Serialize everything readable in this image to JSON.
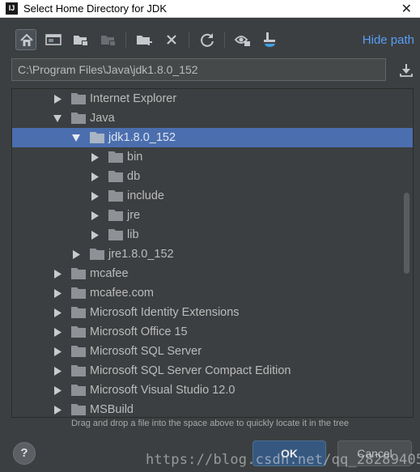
{
  "window": {
    "logo": "IJ",
    "title": "Select Home Directory for JDK",
    "close": "✕"
  },
  "toolbar": {
    "buttons": [
      {
        "icon": "home-icon",
        "tooltip": ""
      },
      {
        "icon": "desktop-icon"
      },
      {
        "icon": "project-folder-icon"
      },
      {
        "icon": "module-folder-icon"
      },
      {
        "icon": "new-folder-icon"
      },
      {
        "icon": "delete-icon"
      },
      {
        "icon": "refresh-icon"
      },
      {
        "icon": "show-hidden-icon"
      },
      {
        "icon": "jdk-icon"
      }
    ],
    "hide_path_label": "Hide path"
  },
  "path": {
    "value": "C:\\Program Files\\Java\\jdk1.8.0_152"
  },
  "tree": {
    "items": [
      {
        "label": "Internet Explorer",
        "depth": 0,
        "expanded": false,
        "selected": false
      },
      {
        "label": "Java",
        "depth": 0,
        "expanded": true,
        "selected": false
      },
      {
        "label": "jdk1.8.0_152",
        "depth": 1,
        "expanded": true,
        "selected": true
      },
      {
        "label": "bin",
        "depth": 2,
        "expanded": false,
        "selected": false
      },
      {
        "label": "db",
        "depth": 2,
        "expanded": false,
        "selected": false
      },
      {
        "label": "include",
        "depth": 2,
        "expanded": false,
        "selected": false
      },
      {
        "label": "jre",
        "depth": 2,
        "expanded": false,
        "selected": false
      },
      {
        "label": "lib",
        "depth": 2,
        "expanded": false,
        "selected": false
      },
      {
        "label": "jre1.8.0_152",
        "depth": 1,
        "expanded": false,
        "selected": false
      },
      {
        "label": "mcafee",
        "depth": 0,
        "expanded": false,
        "selected": false
      },
      {
        "label": "mcafee.com",
        "depth": 0,
        "expanded": false,
        "selected": false
      },
      {
        "label": "Microsoft Identity Extensions",
        "depth": 0,
        "expanded": false,
        "selected": false
      },
      {
        "label": "Microsoft Office 15",
        "depth": 0,
        "expanded": false,
        "selected": false
      },
      {
        "label": "Microsoft SQL Server",
        "depth": 0,
        "expanded": false,
        "selected": false
      },
      {
        "label": "Microsoft SQL Server Compact Edition",
        "depth": 0,
        "expanded": false,
        "selected": false
      },
      {
        "label": "Microsoft Visual Studio 12.0",
        "depth": 0,
        "expanded": false,
        "selected": false
      },
      {
        "label": "MSBuild",
        "depth": 0,
        "expanded": false,
        "selected": false
      }
    ]
  },
  "hint": "Drag and drop a file into the space above to quickly locate it in the tree",
  "footer": {
    "help_label": "?",
    "ok_label": "OK",
    "cancel_label": "Cancel"
  },
  "watermark": "https://blog.csdn.net/qq_28289405",
  "colors": {
    "background": "#3c3f41",
    "selection": "#4b6eaf",
    "link": "#589df6",
    "folder": "#8e9297",
    "ok_button": "#365880"
  }
}
